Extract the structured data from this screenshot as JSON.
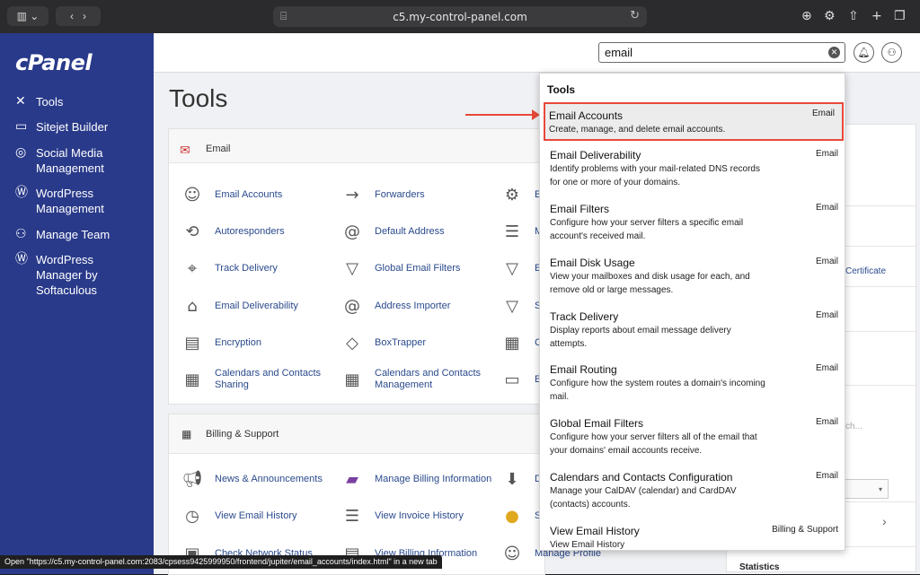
{
  "browser": {
    "url": "c5.my-control-panel.com",
    "status_link": "Open \"https://c5.my-control-panel.com:2083/cpsess9425999950/frontend/jupiter/email_accounts/index.html\" in a new tab"
  },
  "sidebar": {
    "logo": "cPanel",
    "items": [
      {
        "label": "Tools",
        "icon": "tools-icon"
      },
      {
        "label": "Sitejet Builder",
        "icon": "sitejet-icon"
      },
      {
        "label": "Social Media Management",
        "icon": "social-media-icon"
      },
      {
        "label": "WordPress Management",
        "icon": "wordpress-icon"
      },
      {
        "label": "Manage Team",
        "icon": "team-icon"
      },
      {
        "label": "WordPress Manager by Softaculous",
        "icon": "wordpress-icon"
      }
    ]
  },
  "header": {
    "search_value": "email"
  },
  "main": {
    "title": "Tools",
    "email_section": {
      "title": "Email",
      "tools": [
        "Email Accounts",
        "Forwarders",
        "E",
        "Autoresponders",
        "Default Address",
        "M",
        "Track Delivery",
        "Global Email Filters",
        "E",
        "Email Deliverability",
        "Address Importer",
        "S",
        "Encryption",
        "BoxTrapper",
        "C",
        "Calendars and Contacts Sharing",
        "Calendars and Contacts Management",
        "E"
      ]
    },
    "billing_section": {
      "title": "Billing & Support",
      "tools": [
        "News & Announcements",
        "Manage Billing Information",
        "D",
        "View Email History",
        "View Invoice History",
        "S",
        "Check Network Status",
        "View Billing Information",
        "Manage Profile"
      ]
    },
    "right_col": {
      "certificate_text": "Certificate",
      "search_hint": "ch...",
      "statistics_label": "Statistics"
    }
  },
  "dropdown": {
    "heading": "Tools",
    "items": [
      {
        "title": "Email Accounts",
        "desc": "Create, manage, and delete email accounts.",
        "category": "Email"
      },
      {
        "title": "Email Deliverability",
        "desc": "Identify problems with your mail-related DNS records for one or more of your domains.",
        "category": "Email"
      },
      {
        "title": "Email Filters",
        "desc": "Configure how your server filters a specific email account's received mail.",
        "category": "Email"
      },
      {
        "title": "Email Disk Usage",
        "desc": "View your mailboxes and disk usage for each, and remove old or large messages.",
        "category": "Email"
      },
      {
        "title": "Track Delivery",
        "desc": "Display reports about email message delivery attempts.",
        "category": "Email"
      },
      {
        "title": "Email Routing",
        "desc": "Configure how the system routes a domain's incoming mail.",
        "category": "Email"
      },
      {
        "title": "Global Email Filters",
        "desc": "Configure how your server filters all of the email that your domains' email accounts receive.",
        "category": "Email"
      },
      {
        "title": "Calendars and Contacts Configuration",
        "desc": "Manage your CalDAV (calendar) and CardDAV (contacts) accounts.",
        "category": "Email"
      },
      {
        "title": "View Email History",
        "desc": "View Email History",
        "category": "Billing & Support"
      }
    ]
  },
  "colors": {
    "sidebar": "#293a8a",
    "highlight": "#e8493a"
  }
}
